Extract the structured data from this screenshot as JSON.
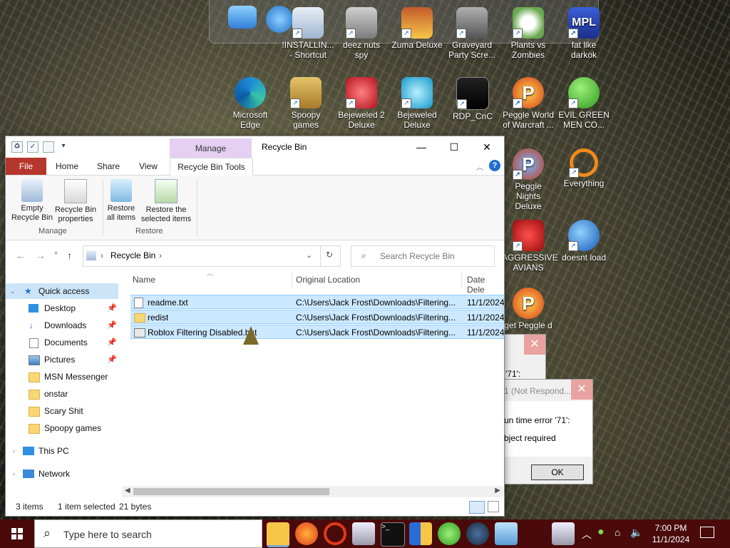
{
  "desktop": {
    "icons": [
      {
        "label": "!INSTALLIN... - Shortcut"
      },
      {
        "label": "deez nuts spy"
      },
      {
        "label": "Zuma Deluxe"
      },
      {
        "label": "Graveyard Party Scre..."
      },
      {
        "label": "Plants vs Zombies"
      },
      {
        "label": "fat like darkok"
      },
      {
        "label": "Microsoft Edge"
      },
      {
        "label": "Spoopy games"
      },
      {
        "label": "Bejeweled 2 Deluxe"
      },
      {
        "label": "Bejeweled Deluxe"
      },
      {
        "label": "RDP_CnC"
      },
      {
        "label": "Peggle World of Warcraft ..."
      },
      {
        "label": "EVIL GREEN MEN CO..."
      },
      {
        "label": "Peggle Nights Deluxe"
      },
      {
        "label": "Everything"
      },
      {
        "label": "AGGRESSIVE AVIANS"
      },
      {
        "label": "doesnt load"
      },
      {
        "label": "get Peggle d"
      }
    ]
  },
  "dialogs": {
    "d1_text": "'71':",
    "d2_title": "1 (Not Respond...",
    "d2_line1": "un time error '71':",
    "d2_line2": "bject required",
    "ok": "OK"
  },
  "explorer": {
    "title": "Recycle Bin",
    "manage_tab": "Manage",
    "tabs": {
      "file": "File",
      "home": "Home",
      "share": "Share",
      "view": "View",
      "tools": "Recycle Bin Tools"
    },
    "ribbon": {
      "empty": "Empty Recycle Bin",
      "props": "Recycle Bin properties",
      "restore_all": "Restore all items",
      "restore_sel": "Restore the selected items",
      "group_manage": "Manage",
      "group_restore": "Restore"
    },
    "address": {
      "path": "Recycle Bin",
      "search_placeholder": "Search Recycle Bin"
    },
    "nav": {
      "quick_access": "Quick access",
      "items": [
        "Desktop",
        "Downloads",
        "Documents",
        "Pictures",
        "MSN Messenger",
        "onstar",
        "Scary Shit",
        "Spoopy games"
      ],
      "this_pc": "This PC",
      "network": "Network"
    },
    "columns": {
      "name": "Name",
      "orig": "Original Location",
      "date": "Date Dele"
    },
    "files": [
      {
        "name": "readme.txt",
        "orig": "C:\\Users\\Jack Frost\\Downloads\\Filtering...",
        "date": "11/1/2024"
      },
      {
        "name": "redist",
        "orig": "C:\\Users\\Jack Frost\\Downloads\\Filtering...",
        "date": "11/1/2024"
      },
      {
        "name": "Roblox Filtering Disabled.bat",
        "orig": "C:\\Users\\Jack Frost\\Downloads\\Filtering...",
        "date": "11/1/2024"
      }
    ],
    "status": {
      "count": "3 items",
      "selected": "1 item selected",
      "size": "21 bytes"
    }
  },
  "taskbar": {
    "search_placeholder": "Type here to search",
    "time": "7:00 PM",
    "date": "11/1/2024"
  }
}
